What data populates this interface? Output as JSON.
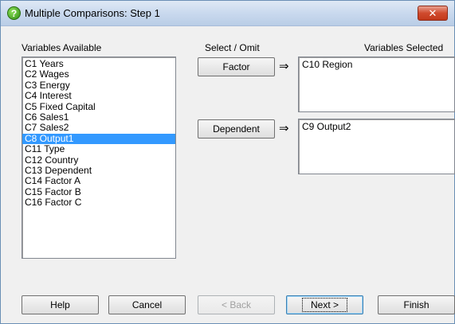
{
  "window": {
    "title": "Multiple Comparisons: Step 1",
    "close_glyph": "✕"
  },
  "labels": {
    "variables_available": "Variables Available",
    "select_omit": "Select / Omit",
    "variables_selected": "Variables Selected"
  },
  "variables": [
    "C1 Years",
    "C2 Wages",
    "C3 Energy",
    "C4 Interest",
    "C5 Fixed Capital",
    "C6 Sales1",
    "C7 Sales2",
    "C8 Output1",
    "C11 Type",
    "C12 Country",
    "C13 Dependent",
    "C14 Factor A",
    "C15 Factor B",
    "C16 Factor C"
  ],
  "selected_index": 7,
  "factor": {
    "button_label": "Factor",
    "arrow": "⇒",
    "value": "C10 Region"
  },
  "dependent": {
    "button_label": "Dependent",
    "arrow": "⇒",
    "value": "C9 Output2"
  },
  "buttons": {
    "help": "Help",
    "cancel": "Cancel",
    "back": "< Back",
    "next": "Next >",
    "finish": "Finish"
  }
}
